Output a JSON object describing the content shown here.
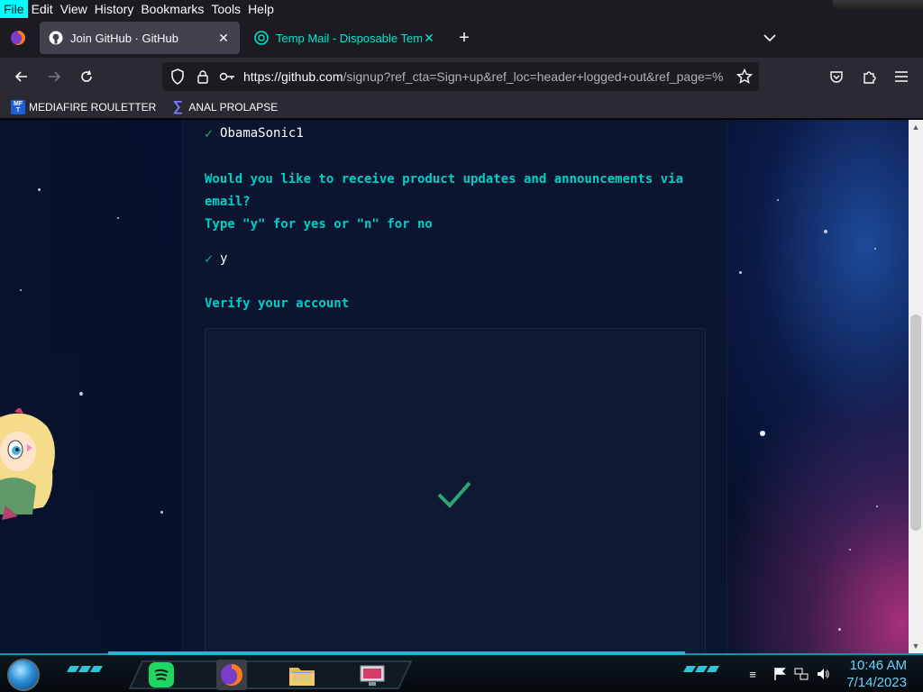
{
  "menubar": {
    "items": [
      {
        "label": "File",
        "active": true
      },
      {
        "label": "Edit",
        "active": false
      },
      {
        "label": "View",
        "active": false
      },
      {
        "label": "History",
        "active": false
      },
      {
        "label": "Bookmarks",
        "active": false
      },
      {
        "label": "Tools",
        "active": false
      },
      {
        "label": "Help",
        "active": false
      }
    ]
  },
  "tabs": {
    "active": {
      "title": "Join GitHub · GitHub",
      "icon": "github-icon"
    },
    "inactive": {
      "title": "Temp Mail - Disposable Tempo",
      "icon": "tempmail-icon",
      "color": "#00e7d0"
    },
    "new_tab_label": "+"
  },
  "navbar": {
    "url_host": "https://github.com",
    "url_rest": "/signup?ref_cta=Sign+up&ref_loc=header+logged+out&ref_page=%"
  },
  "bookmarks": [
    {
      "label": "MEDIAFIRE ROULETTER",
      "icon": "mediafire-icon",
      "icon_text": "MF T"
    },
    {
      "label": "ANAL PROLAPSE",
      "icon": "bookmark-sigma-icon",
      "icon_text": "∑"
    }
  ],
  "signup": {
    "username_answer": "ObamaSonic1",
    "email_prompt_line1": "Would you like to receive product updates and announcements via",
    "email_prompt_line2": "email?",
    "email_prompt_line3": "Type \"y\" for yes or \"n\" for no",
    "email_answer": "y",
    "verify_heading": "Verify your account",
    "answer_check": "✓"
  },
  "taskbar": {
    "time": "10:46 AM",
    "date": "7/14/2023",
    "apps": [
      "spotify-icon",
      "firefox-icon",
      "file-explorer-icon",
      "monitor-app-icon"
    ]
  },
  "colors": {
    "accent_cyan": "#00cfc8",
    "check_green": "#2ea66d",
    "clock_blue": "#6ad2ff"
  }
}
